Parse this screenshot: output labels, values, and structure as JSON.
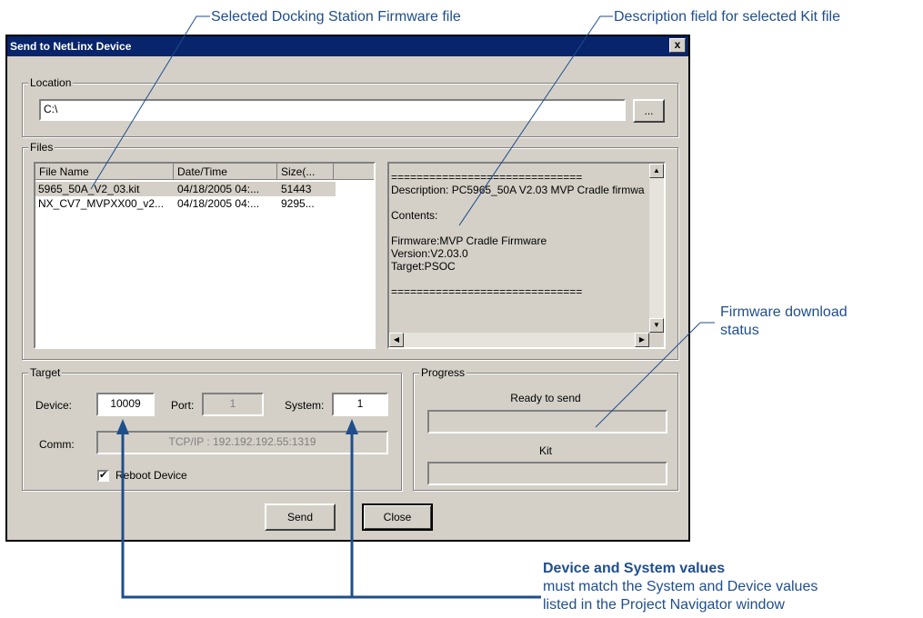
{
  "callouts": {
    "firmware_file": "Selected Docking Station Firmware file",
    "description_field": "Description field for selected Kit file",
    "download_status_1": "Firmware download",
    "download_status_2": "status",
    "device_system_title": "Device and System values",
    "device_system_line1": "must match the System and Device values",
    "device_system_line2": "listed in the Project Navigator window"
  },
  "dialog": {
    "title": "Send to NetLinx Device",
    "close_glyph": "x",
    "location": {
      "legend": "Location",
      "path": "C:\\",
      "browse_label": "..."
    },
    "files": {
      "legend": "Files",
      "columns": [
        "File Name",
        "Date/Time",
        "Size(..."
      ],
      "rows": [
        {
          "name": "5965_50A_V2_03.kit",
          "date": "04/18/2005 04:...",
          "size": "51443"
        },
        {
          "name": "NX_CV7_MVPXX00_v2...",
          "date": "04/18/2005 04:...",
          "size": "9295..."
        }
      ],
      "description_lines": [
        "==============================",
        "Description: PC5965_50A V2.03 MVP Cradle firmwa",
        "",
        "Contents:",
        "",
        "Firmware:MVP Cradle Firmware",
        "Version:V2.03.0",
        "Target:PSOC",
        "",
        "=============================="
      ]
    },
    "target": {
      "legend": "Target",
      "device_label": "Device:",
      "device_value": "10009",
      "port_label": "Port:",
      "port_value": "1",
      "system_label": "System:",
      "system_value": "1",
      "comm_label": "Comm:",
      "comm_value": "TCP/IP : 192.192.192.55:1319",
      "reboot_label": "Reboot Device",
      "reboot_checked": true
    },
    "progress": {
      "legend": "Progress",
      "status": "Ready to send",
      "kit_label": "Kit",
      "file_progress": 0,
      "kit_progress": 0
    },
    "buttons": {
      "send": "Send",
      "close": "Close"
    }
  },
  "colors": {
    "callout": "#1f4e8c",
    "titlebar": "#08246b",
    "dialog_bg": "#d4d0c8"
  }
}
